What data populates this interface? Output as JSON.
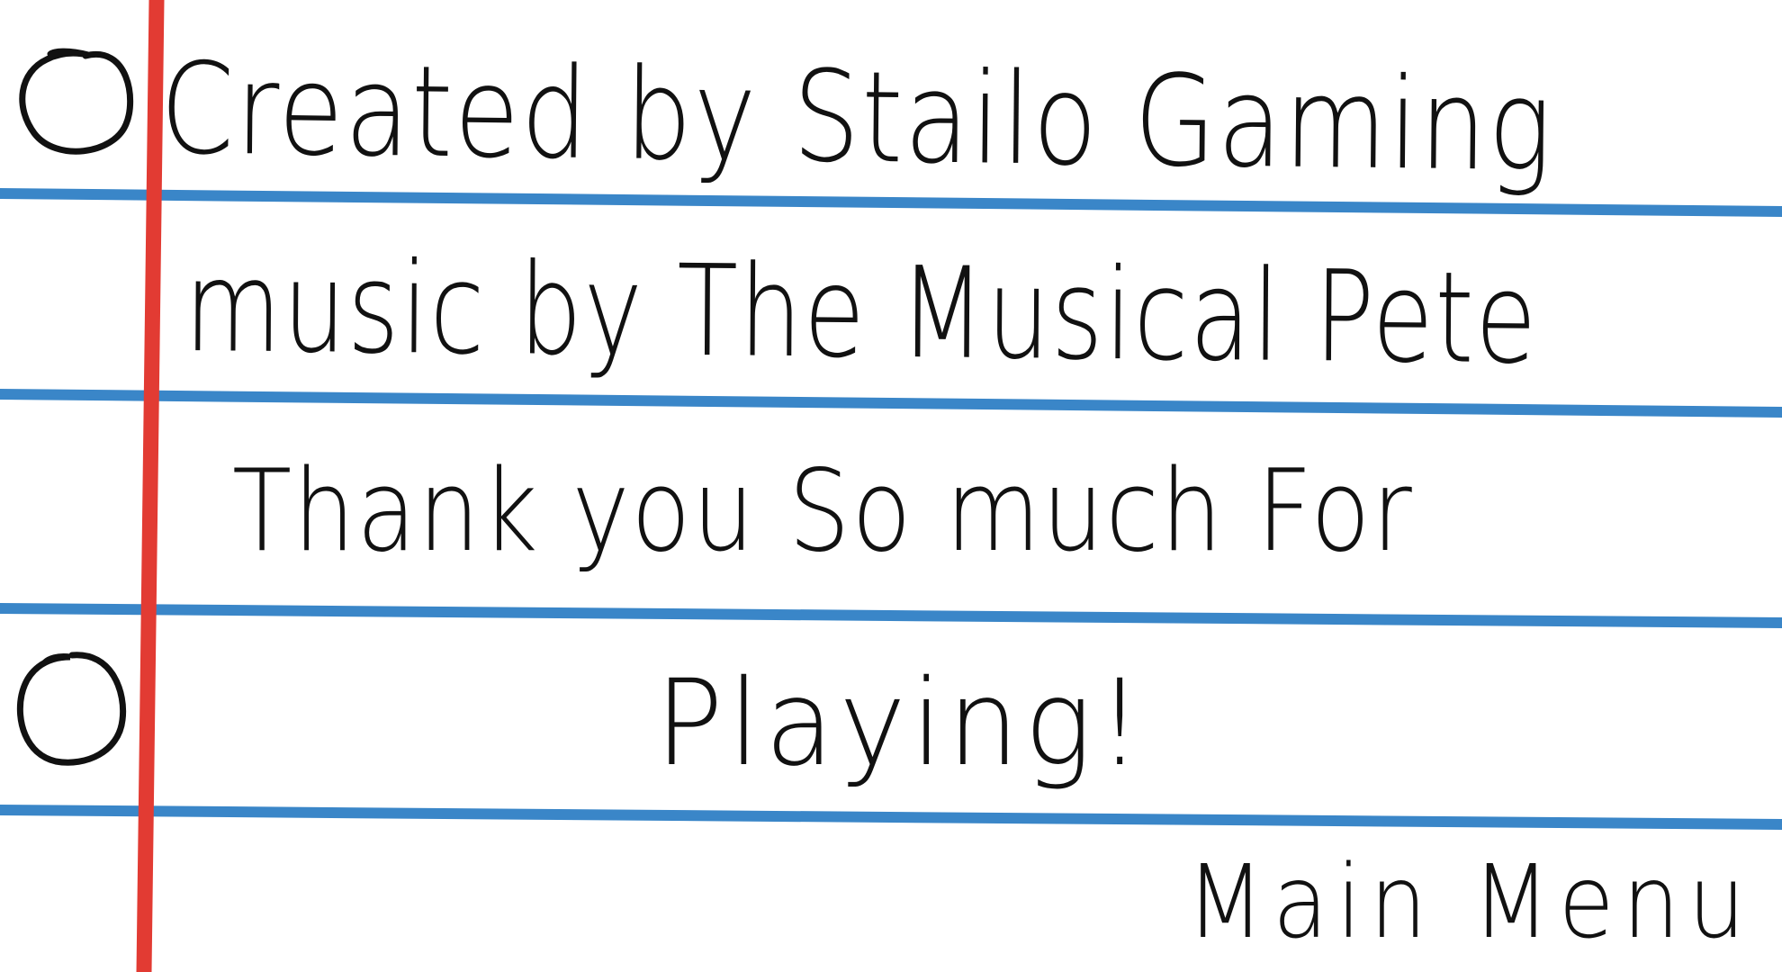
{
  "screen": "credits",
  "paper": {
    "rule_color": "#3a86c8",
    "margin_color": "#e23b33",
    "ink_color": "#111111",
    "background": "#ffffff",
    "punch_holes": 2
  },
  "credits": {
    "created_by": "Created by Stailo Gaming",
    "music_by": "music by The Musical Pete",
    "thanks_line1": "Thank you So much For",
    "thanks_line2": "Playing!"
  },
  "menu": {
    "main_menu_label": "Main Menu"
  }
}
